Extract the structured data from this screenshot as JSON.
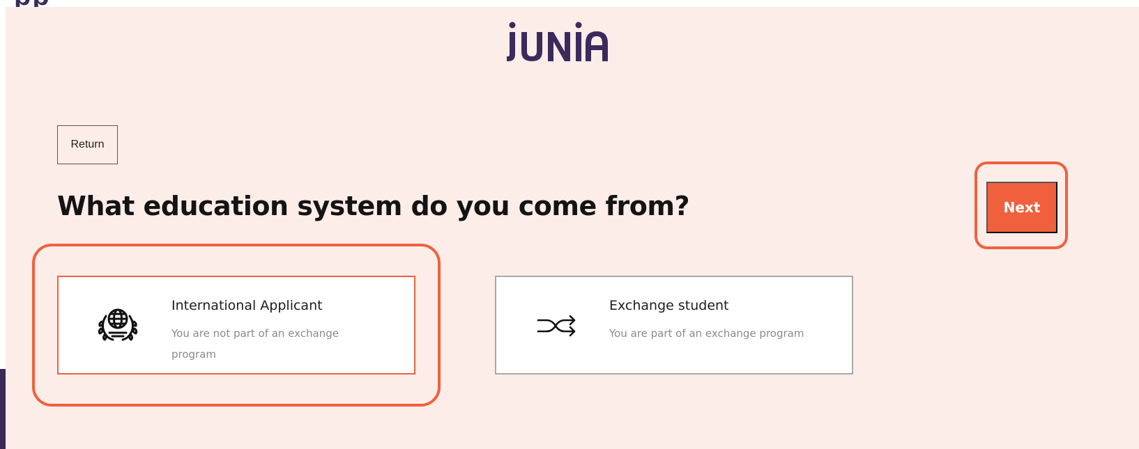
{
  "header": {
    "top_fragment": "pp",
    "logo_text": "JUNIA"
  },
  "nav": {
    "return_label": "Return",
    "next_label": "Next"
  },
  "question": {
    "heading": "What education system do you come from?"
  },
  "options": [
    {
      "title": "International Applicant",
      "description": "You are not part of an exchange program",
      "icon": "globe-laurel-icon",
      "selected": true
    },
    {
      "title": "Exchange student",
      "description": "You are part of an exchange program",
      "icon": "shuffle-icon",
      "selected": false
    }
  ],
  "colors": {
    "accent": "#f1603d",
    "brand": "#3d2a5c",
    "background": "#fdede9"
  }
}
